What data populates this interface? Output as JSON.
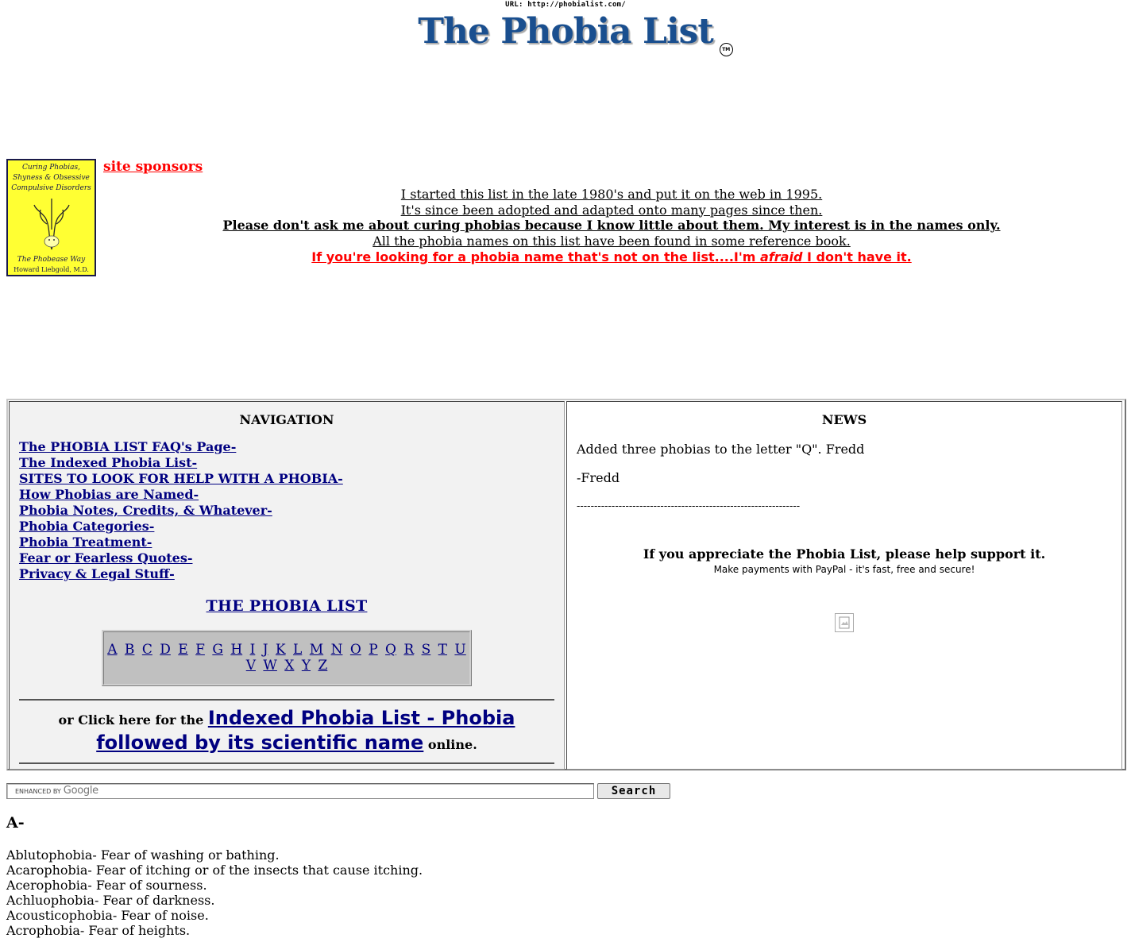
{
  "header": {
    "url_text": "URL: http://phobialist.com/",
    "logo_text": "The Phobia List",
    "trademark": "TM"
  },
  "sponsor_book": {
    "title": "Curing Phobias, Shyness & Obsessive Compulsive Disorders",
    "subtitle": "The Phobease Way",
    "author": "Howard Liebgold, M.D."
  },
  "sponsors_link": "site sponsors",
  "intro": {
    "line1": "I started this list in the late 1980's and put it on the web in 1995.",
    "line2": "It's since been adopted and adapted onto many pages since then.",
    "line3": "Please don't ask me about curing phobias because I know little about them. My interest is in the names only.",
    "line4": "All the phobia names on this list have been found in some reference book.",
    "line5_a": "If you're looking for a phobia name that's not on the list....I'm ",
    "line5_em": "afraid",
    "line5_b": " I don't have it."
  },
  "navigation": {
    "title": "NAVIGATION",
    "links": [
      "The PHOBIA LIST FAQ's Page-",
      "The Indexed Phobia List-",
      "SITES TO LOOK FOR HELP WITH A PHOBIA-",
      "How Phobias are Named-",
      "Phobia Notes, Credits, & Whatever-",
      "Phobia Categories-",
      "Phobia Treatment-",
      "Fear or Fearless Quotes-",
      "Privacy & Legal Stuff-"
    ],
    "list_title": "THE PHOBIA LIST",
    "alphabet": [
      "A",
      "B",
      "C",
      "D",
      "E",
      "F",
      "G",
      "H",
      "I",
      "J",
      "K",
      "L",
      "M",
      "N",
      "O",
      "P",
      "Q",
      "R",
      "S",
      "T",
      "U",
      "V",
      "W",
      "X",
      "Y",
      "Z"
    ],
    "indexed_prefix": "or Click here for the ",
    "indexed_link": "Indexed Phobia List - Phobia followed by its scientific name",
    "indexed_suffix": " online."
  },
  "news": {
    "title": "NEWS",
    "item1": "Added three phobias to the letter \"Q\". Fredd",
    "item2": "-Fredd",
    "divider": "----------------------------------------------------------------",
    "support_title": "If you appreciate the Phobia List, please help support it.",
    "support_sub": "Make payments with PayPal - it's fast, free and secure!"
  },
  "search": {
    "placeholder_prefix": "ENHANCED BY",
    "placeholder_brand": "Google",
    "button_label": "Search"
  },
  "list": {
    "letter_heading": "A-",
    "entries": [
      "Ablutophobia- Fear of washing or bathing.",
      "Acarophobia- Fear of itching or of the insects that cause itching.",
      "Acerophobia- Fear of sourness.",
      "Achluophobia- Fear of darkness.",
      "Acousticophobia- Fear of noise.",
      "Acrophobia- Fear of heights."
    ]
  }
}
